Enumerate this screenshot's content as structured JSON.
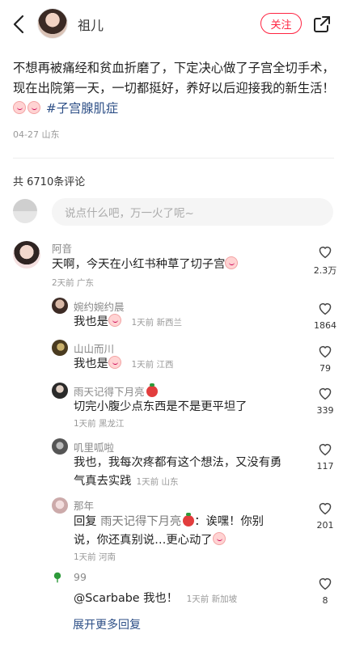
{
  "header": {
    "username": "祖儿",
    "follow_label": "关注"
  },
  "post": {
    "text": "不想再被痛经和贫血折磨了，下定决心做了子宫全切手术，现在出院第一天，一切都挺好，养好以后迎接我的新生活！",
    "tag": "#子宫腺肌症",
    "date": "04-27",
    "location": "山东"
  },
  "comments_section": {
    "count_label": "共 6710条评论",
    "input_placeholder": "说点什么吧，万一火了呢~"
  },
  "comments": [
    {
      "name": "阿音",
      "text": "天啊，今天在小红书种草了切子宫",
      "time": "2天前",
      "location": "广东",
      "likes": "2.3万"
    },
    {
      "name": "婉约婉约晨",
      "text": "我也是",
      "time": "1天前",
      "location": "新西兰",
      "likes": "1864"
    },
    {
      "name": "山山而川",
      "text": "我也是",
      "time": "1天前",
      "location": "江西",
      "likes": "79"
    },
    {
      "name": "雨天记得下月亮",
      "text": "切完小腹少点东西是不是更平坦了",
      "time": "1天前",
      "location": "黑龙江",
      "likes": "339"
    },
    {
      "name": "叽里呱啦",
      "text_line1": "我也，我每次疼都有这个想法，又没有勇",
      "text_line2": "气真去实践",
      "time": "1天前",
      "location": "山东",
      "likes": "117"
    },
    {
      "name": "那年",
      "reply_prefix": "回复",
      "reply_to": "雨天记得下月亮",
      "text_line1_after": "：诶嘿！你别",
      "text_line2": "说，你还真别说…更心动了",
      "time": "1天前",
      "location": "河南",
      "likes": "201"
    },
    {
      "name": "99",
      "mention": "@Scarbabe",
      "text": "我也！",
      "time": "1天前",
      "location": "新加坡",
      "likes": "8"
    }
  ],
  "more_replies_label": "展开更多回复"
}
